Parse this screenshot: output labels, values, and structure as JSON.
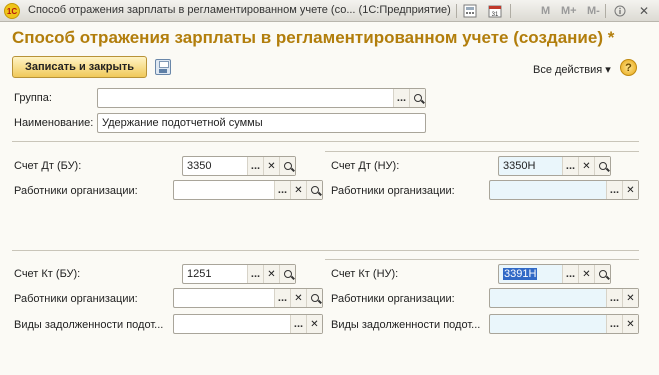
{
  "window": {
    "title": "Способ отражения зарплаты в регламентированном учете (со...  (1С:Предприятие)",
    "logo_text": "1С",
    "toolbar_labels": [
      "M",
      "M+",
      "M-"
    ],
    "close_glyph": "✕",
    "min_glyph": "_",
    "max_glyph": "□"
  },
  "form": {
    "title": "Способ отражения зарплаты в регламентированном учете (создание) *",
    "save_close_label": "Записать и закрыть",
    "all_actions_label": "Все действия ▾",
    "help_label": "?"
  },
  "header_fields": {
    "group_label": "Группа:",
    "group_value": "",
    "name_label": "Наименование:",
    "name_value": "Удержание подотчетной суммы"
  },
  "debit": {
    "bu_label": "Счет Дт (БУ):",
    "bu_value": "3350",
    "nu_label": "Счет Дт (НУ):",
    "nu_value": "3350Н",
    "workers_bu_label": "Работники организации:",
    "workers_bu_value": "",
    "workers_nu_label": "Работники организации:",
    "workers_nu_value": ""
  },
  "credit": {
    "bu_label": "Счет Кт (БУ):",
    "bu_value": "1251",
    "nu_label": "Счет Кт (НУ):",
    "nu_value": "3391Н",
    "workers_bu_label": "Работники организации:",
    "workers_bu_value": "",
    "workers_nu_label": "Работники организации:",
    "workers_nu_value": "",
    "debt_bu_label": "Виды задолженности подот...",
    "debt_bu_value": "",
    "debt_nu_label": "Виды задолженности подот...",
    "debt_nu_value": ""
  },
  "icons": {
    "select": "...",
    "clear": "✕",
    "search": "search-icon"
  },
  "colors": {
    "title": "#b27e0c",
    "button": "#f0c95a",
    "nu_field": "#eaf6fb",
    "selection": "#3169c6"
  }
}
